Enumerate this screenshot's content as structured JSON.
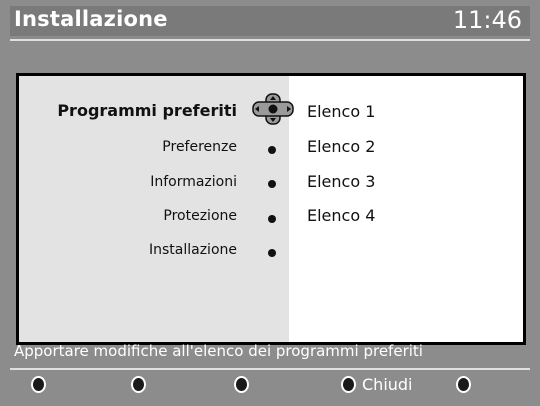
{
  "header": {
    "title": "Installazione",
    "time": "11:46"
  },
  "menu": {
    "items": [
      {
        "label": "Programmi preferiti",
        "active": true
      },
      {
        "label": "Preferenze",
        "active": false
      },
      {
        "label": "Informazioni",
        "active": false
      },
      {
        "label": "Protezione",
        "active": false
      },
      {
        "label": "Installazione",
        "active": false
      }
    ]
  },
  "submenu": {
    "items": [
      {
        "label": "Elenco 1"
      },
      {
        "label": "Elenco 2"
      },
      {
        "label": "Elenco 3"
      },
      {
        "label": "Elenco 4"
      }
    ]
  },
  "status": {
    "text": "Apportare modifiche all'elenco dei programmi preferiti"
  },
  "footer": {
    "keys": [
      {
        "icon": "red-key-icon",
        "label": ""
      },
      {
        "icon": "green-key-icon",
        "label": ""
      },
      {
        "icon": "yellow-key-icon",
        "label": ""
      },
      {
        "icon": "blue-key-icon",
        "label": "Chiudi"
      },
      {
        "icon": "menu-key-icon",
        "label": ""
      }
    ]
  },
  "colors": {
    "background": "#8c8c8c",
    "panel_left": "#e3e3e3",
    "panel_right": "#ffffff",
    "text": "#111111",
    "header_text": "#ffffff"
  }
}
